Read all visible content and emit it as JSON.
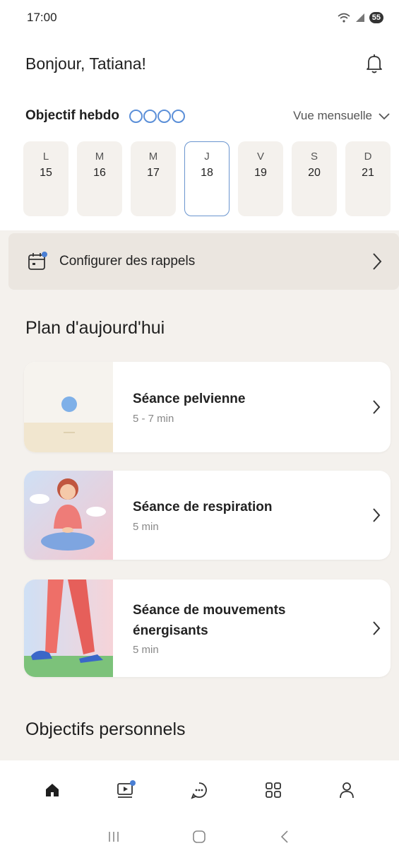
{
  "status": {
    "time": "17:00",
    "battery": "55"
  },
  "header": {
    "greeting": "Bonjour, Tatiana!"
  },
  "week": {
    "title": "Objectif hebdo",
    "month_toggle": "Vue mensuelle"
  },
  "days": [
    {
      "letter": "L",
      "num": "15"
    },
    {
      "letter": "M",
      "num": "16"
    },
    {
      "letter": "M",
      "num": "17"
    },
    {
      "letter": "J",
      "num": "18",
      "active": true
    },
    {
      "letter": "V",
      "num": "19"
    },
    {
      "letter": "S",
      "num": "20"
    },
    {
      "letter": "D",
      "num": "21"
    }
  ],
  "reminder": {
    "label": "Configurer des rappels"
  },
  "plan": {
    "title": "Plan d'aujourd'hui",
    "sessions": [
      {
        "title": "Séance pelvienne",
        "duration": "5 - 7 min"
      },
      {
        "title": "Séance de respiration",
        "duration": "5 min"
      },
      {
        "title": "Séance de mouvements énergisants",
        "duration": "5 min"
      }
    ]
  },
  "goals": {
    "title": "Objectifs personnels"
  },
  "nav": [
    {
      "icon": "home-icon",
      "active": true
    },
    {
      "icon": "video-icon"
    },
    {
      "icon": "chat-icon"
    },
    {
      "icon": "grid-icon"
    },
    {
      "icon": "profile-icon"
    }
  ],
  "colors": {
    "accent": "#5b8fd8",
    "background": "#f4f1ed",
    "card": "#ffffff"
  }
}
